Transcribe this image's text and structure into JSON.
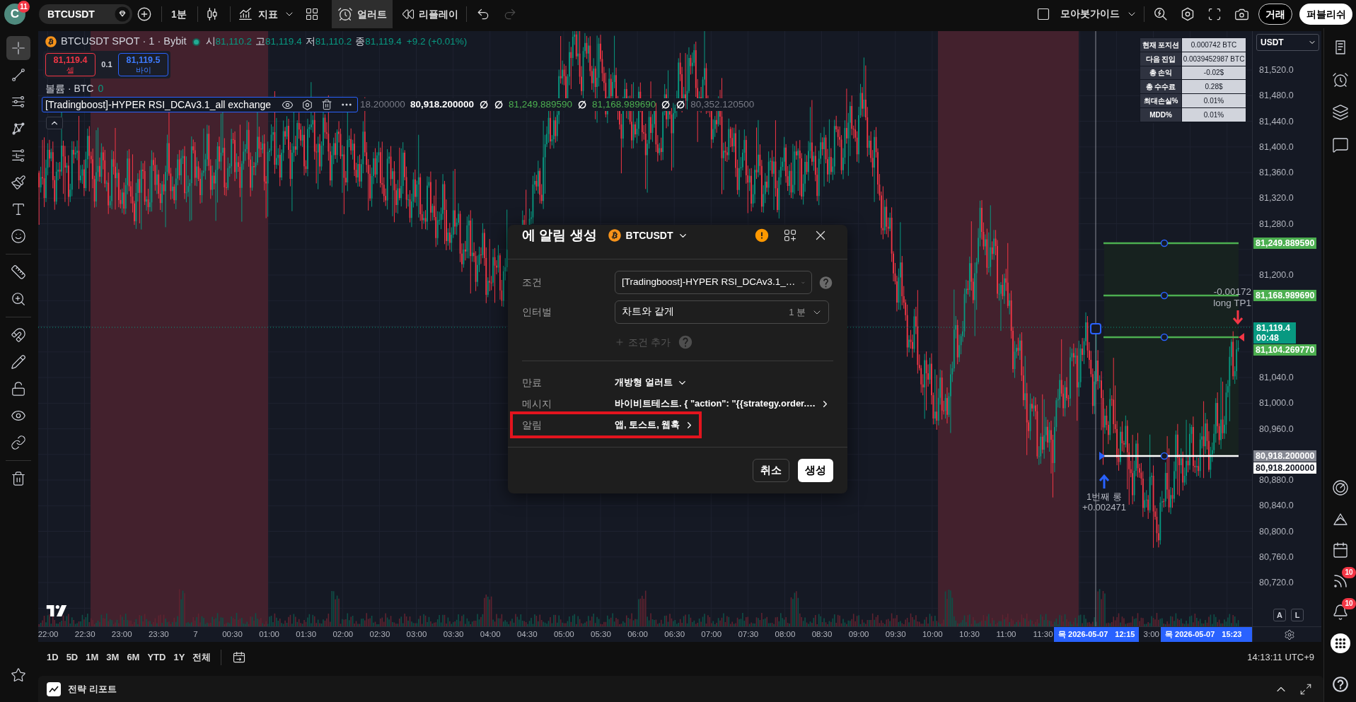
{
  "top_bar": {
    "avatar": {
      "letter": "C",
      "badge": "11"
    },
    "symbol": "BTCUSDT",
    "interval": "1분",
    "indicators": "지표",
    "alert": {
      "label": "얼러트",
      "active": true
    },
    "replay": "리플레이",
    "undo": {
      "disabled": false
    },
    "redo": {
      "disabled": true
    },
    "layout_name": "모아봇가이드",
    "trade": "거래",
    "publish": "퍼블리쉬"
  },
  "left_toolbar": {
    "tools": [
      {
        "selected": true
      },
      {
        "selected": false
      },
      {
        "selected": false
      },
      {
        "selected": false
      },
      {
        "selected": false
      },
      {
        "selected": false
      },
      {
        "selected": false
      },
      {
        "selected": false
      },
      {
        "selected": false
      },
      {
        "selected": false
      },
      {
        "selected": false
      },
      {
        "selected": false
      },
      {
        "selected": false
      },
      {
        "selected": false
      },
      {
        "selected": false
      },
      {
        "selected": false
      }
    ]
  },
  "chart": {
    "legend": {
      "title": "BTCUSDT SPOT · 1 · Bybit",
      "ohlc": [
        {
          "label": "시",
          "value": "81,110.2"
        },
        {
          "label": "고",
          "value": "81,119.4"
        },
        {
          "label": "저",
          "value": "81,110.2"
        },
        {
          "label": "종",
          "value": "81,119.4"
        }
      ],
      "change": "+9.2 (+0.01%)"
    },
    "order_panel": {
      "sell": {
        "price": "81,119.4",
        "label": "셀"
      },
      "quantity": "0.1",
      "buy": {
        "price": "81,119.5",
        "label": "바이"
      }
    },
    "volume_legend": {
      "label": "볼륨 · BTC",
      "value": "0"
    },
    "indicator": {
      "name": "[Tradingboost]-HYPER RSI_DCAv3.1_all exchange",
      "values": [
        {
          "kind": "number",
          "text": "18.200000",
          "color": "#787b86"
        },
        {
          "kind": "emphasis",
          "text": "80,918.200000",
          "color": "#ffffff"
        },
        {
          "kind": "symbol",
          "text": "∅",
          "color": "#ffffff"
        },
        {
          "kind": "symbol",
          "text": "∅",
          "color": "#ffffff"
        },
        {
          "kind": "number",
          "text": "81,249.889590",
          "color": "#4caf50"
        },
        {
          "kind": "symbol",
          "text": "∅",
          "color": "#ffffff"
        },
        {
          "kind": "number",
          "text": "81,168.989690",
          "color": "#4caf50"
        },
        {
          "kind": "symbol",
          "text": "∅",
          "color": "#ffffff"
        },
        {
          "kind": "symbol",
          "text": "∅",
          "color": "#ffffff"
        },
        {
          "kind": "number",
          "text": "80,352.120500",
          "color": "#787b86"
        }
      ]
    },
    "stats_table": [
      {
        "label": "현재 포지션",
        "value": "0.000742 BTC"
      },
      {
        "label": "다음 진입",
        "value": "0.0039452987 BTC"
      },
      {
        "label": "총 손익",
        "value": "-0.02$"
      },
      {
        "label": "총 수수료",
        "value": "0.28$"
      },
      {
        "label": "최대손실%",
        "value": "0.01%"
      },
      {
        "label": "MDD%",
        "value": "0.01%"
      }
    ],
    "position_tool": {
      "target_pnl": "-0.00172",
      "target_name": "long TP1",
      "entry_name": "1번째 롱",
      "entry_size": "+0.002471"
    },
    "price_axis": {
      "currency": "USDT",
      "ticks": [
        "81,520.0",
        "81,480.0",
        "81,440.0",
        "81,400.0",
        "81,360.0",
        "81,320.0",
        "81,280.0",
        "81,200.0",
        "81,040.0",
        "81,000.0",
        "80,960.0",
        "80,880.0",
        "80,840.0",
        "80,800.0",
        "80,760.0",
        "80,720.0"
      ],
      "labels": [
        {
          "text": "81,249.889590",
          "color": "#4caf50"
        },
        {
          "text": "81,168.989690",
          "color": "#4caf50"
        },
        {
          "text": "81,119.4",
          "countdown": "00:48",
          "color": "#089981"
        },
        {
          "text": "81,104.269770",
          "color": "#4caf50"
        },
        {
          "text": "80,918.200000",
          "color": "#868993"
        },
        {
          "text": "80,918.200000",
          "color": "#ffffff"
        }
      ],
      "scale_buttons": [
        "A",
        "L"
      ]
    },
    "time_axis": {
      "ticks": [
        "22:00",
        "22:30",
        "23:00",
        "23:30",
        "7",
        "00:30",
        "01:00",
        "01:30",
        "02:00",
        "02:30",
        "03:00",
        "03:30",
        "04:00",
        "04:30",
        "05:00",
        "05:30",
        "06:00",
        "06:30",
        "07:00",
        "07:30",
        "08:00",
        "08:30",
        "09:00",
        "09:30",
        "10:00",
        "10:30",
        "11:00",
        "11:30"
      ],
      "partial_tick": "3:00",
      "cursor_labels": [
        {
          "date": "목 2026-05-07",
          "time": "12:15"
        },
        {
          "date": "목 2026-05-07",
          "time": "15:23"
        }
      ]
    }
  },
  "bottom_toolbar": {
    "ranges": [
      "1D",
      "5D",
      "1M",
      "3M",
      "6M",
      "YTD",
      "1Y",
      "전체"
    ],
    "clock": "14:13:11 UTC+9"
  },
  "strategy_panel": {
    "title": "전략 리포트"
  },
  "right_toolbar": {
    "badges": [
      "10",
      "10"
    ]
  },
  "alert_dialog": {
    "title": "에 알림 생성",
    "symbol": "BTCUSDT",
    "condition_rows": [
      {
        "kind": "select",
        "label": "조건",
        "value": "[Tradingboost]-HYPER RSI_DCAv3.1_…",
        "help": true
      },
      {
        "kind": "select",
        "label": "인터벌",
        "value": "차트와 같게",
        "suffix": "1 분",
        "help": false
      },
      {
        "kind": "add",
        "value": "조건 추가",
        "disabled": true,
        "help": true
      }
    ],
    "option_rows": [
      {
        "kind": "dropdown",
        "label": "만료",
        "value": "개방형 얼러트",
        "highlighted": false
      },
      {
        "kind": "link",
        "label": "메시지",
        "value": "바이비트테스트. { \"action\": \"{{strategy.order.…",
        "highlighted": false
      },
      {
        "kind": "link",
        "label": "알림",
        "value": "앱, 토스트, 웹훅",
        "highlighted": true
      }
    ],
    "cancel": "취소",
    "create": "생성"
  }
}
